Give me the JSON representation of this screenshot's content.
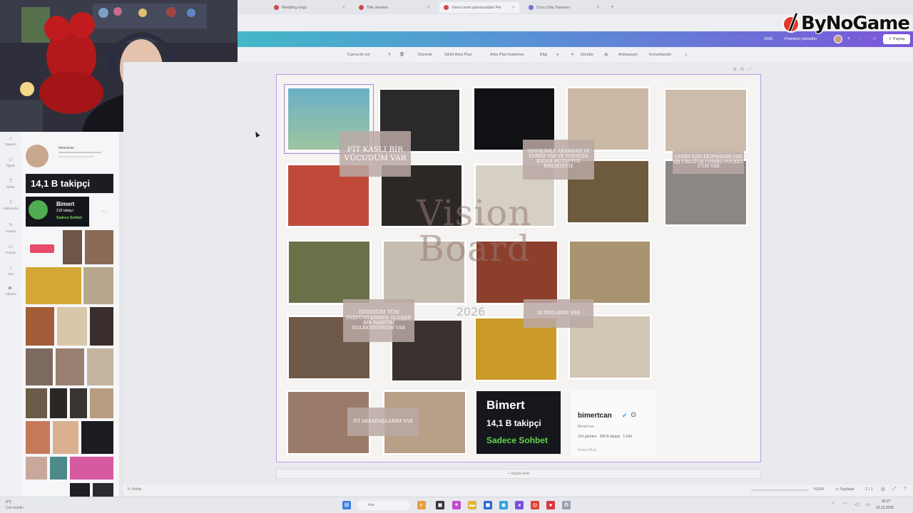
{
  "browser": {
    "tabs": [
      {
        "label": "Wedding rings",
        "favicon": "pinterest-icon"
      },
      {
        "label": "Title dreams",
        "favicon": "pinterest-icon"
      },
      {
        "label": "Vision bord panosundaki Pin",
        "favicon": "pinterest-icon"
      },
      {
        "label": "Cozy Oda Tasarımı",
        "favicon": "canva-icon"
      }
    ],
    "new_tab": "+"
  },
  "header": {
    "title": "2026",
    "premium": "Premium yükseltin",
    "share_label": "Paylaş"
  },
  "toolbar": {
    "items": [
      "Canva ile sor",
      "Düzenle",
      "Sihirli Arka Plan",
      "Arka Plan Kaldırma",
      "Bilgi",
      "Döndür",
      "Animasyon",
      "Konumlandır"
    ]
  },
  "left_rail": {
    "items": [
      "Tasarım",
      "Öğeler",
      "Metin",
      "Yüklemeler",
      "Araçlar",
      "Projeler",
      "Ses",
      "Videolar"
    ]
  },
  "panel": {
    "profile_name": "bimertcan",
    "followers_banner": "14,1 B takipçi",
    "card_name": "Bimert",
    "card_followers": "218 takipçi",
    "card_chat": "Sadece Sohbet"
  },
  "board": {
    "title_line1": "Vision",
    "title_line2": "Board",
    "year": "2026",
    "labels": [
      "FİT KASLI BİR VÜCUDUM VAR",
      "SEVGİLİMLE ARABAMIZ VE EVİMİZ VAR VE SONSUZA KADAR MUTLUYUZ BİRLİKTEYİZ",
      "ÇEKİM İÇİN EKİPMANIM VAR DJI CREATOR COMBO POCKET 3'ÜM VAR",
      "İSTEDİĞİM TÜM PARFÜMLERDEN OLUŞAN BİR PARFÜM KOLEKSİYONUM VAR",
      "ALTINLARIM VAR",
      "İYİ ARKADAŞLARIM VAR"
    ],
    "bimert_card": {
      "name": "Bimert",
      "followers": "14,1 B takipçi",
      "chat": "Sadece Sohbet"
    },
    "profile": {
      "username": "bimertcan",
      "display": "Bimertcan",
      "stats": "310 gönderi   208 B takipçi   1.634",
      "link": "Kişisel Blog"
    }
  },
  "footer": {
    "add_page": "+ Sayfa ekle",
    "notes": "Notlar",
    "zoom": "%100",
    "pages": "Sayfalar",
    "page_count": "1 / 1"
  },
  "taskbar": {
    "search": "Ara",
    "time": "00:27",
    "date": "20.12.2025",
    "weather": "4°C",
    "weather_desc": "Çok bulutlu"
  },
  "logo": {
    "text": "ByNoGame"
  }
}
